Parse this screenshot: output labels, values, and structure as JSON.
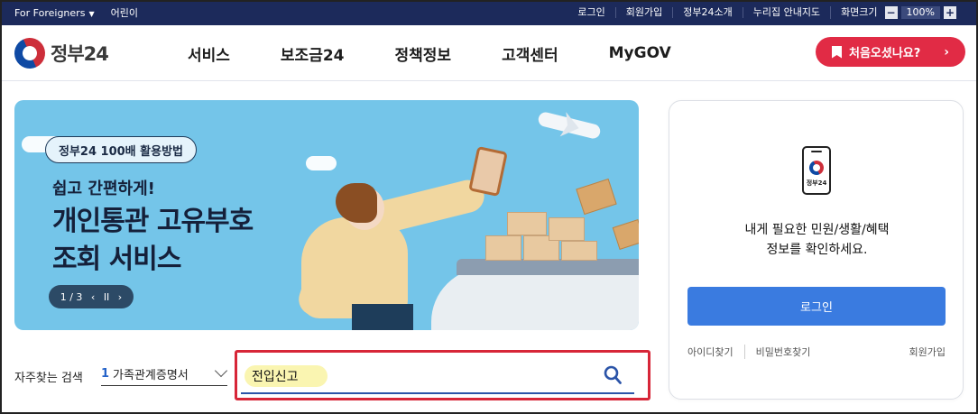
{
  "topbar": {
    "foreigners": "For Foreigners",
    "kids": "어린이",
    "links": [
      "로그인",
      "회원가입",
      "정부24소개",
      "누리집 안내지도"
    ],
    "zoom_label": "화면크기",
    "zoom_minus": "−",
    "zoom_value": "100%",
    "zoom_plus": "+"
  },
  "header": {
    "logo_text": "정부24",
    "nav": [
      "서비스",
      "보조금24",
      "정책정보",
      "고객센터",
      "MyGOV"
    ],
    "cta_label": "처음오셨나요?",
    "cta_arrow": "›"
  },
  "banner": {
    "tag": "정부24 100배 활용방법",
    "sub": "쉽고 간편하게!",
    "headline_line1": "개인통관 고유부호",
    "headline_line2": "조회 서비스",
    "pager_index": "1 / 3",
    "pager_prev": "‹",
    "pager_pause": "II",
    "pager_next": "›"
  },
  "search": {
    "freq_label": "자주찾는 검색",
    "freq_num": "1",
    "freq_value": "가족관계증명서",
    "query": "전입신고"
  },
  "card": {
    "device_label": "정부24",
    "msg_line1": "내게 필요한 민원/생활/혜택",
    "msg_line2": "정보를 확인하세요.",
    "login": "로그인",
    "find_id": "아이디찾기",
    "find_pw": "비밀번호찾기",
    "signup": "회원가입"
  },
  "colors": {
    "topbar": "#1c2a5b",
    "cta": "#e12b45",
    "banner": "#74c5e9",
    "login_button": "#3a7be0",
    "search_highlight_border": "#d72638"
  }
}
